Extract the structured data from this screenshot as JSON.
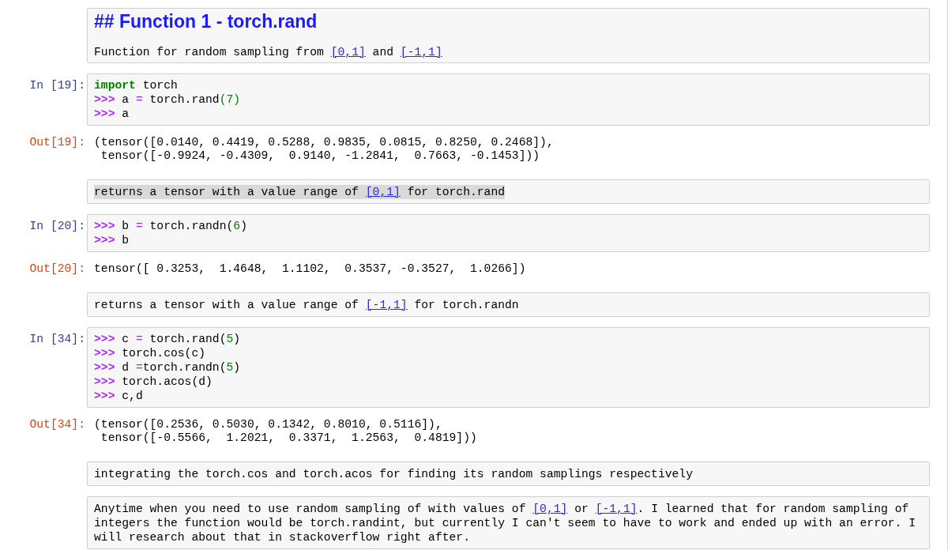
{
  "cells": [
    {
      "kind": "markdown",
      "highlighted": false,
      "heading": "## Function 1 - torch.rand",
      "paragraph": [
        {
          "kind": "text",
          "text": "Function for random sampling from "
        },
        {
          "kind": "link",
          "text": "[0,1]"
        },
        {
          "kind": "text",
          "text": " and "
        },
        {
          "kind": "link",
          "text": "[-1,1]"
        }
      ]
    },
    {
      "kind": "code",
      "prompt": "In [19]:",
      "lines": [
        [
          {
            "kind": "keyword",
            "text": "import"
          },
          {
            "kind": "plain",
            "text": " torch"
          }
        ],
        [
          {
            "kind": "prompt",
            "text": ">>>"
          },
          {
            "kind": "plain",
            "text": " a "
          },
          {
            "kind": "operator",
            "text": "="
          },
          {
            "kind": "plain",
            "text": " torch.rand"
          },
          {
            "kind": "number",
            "text": "(7)"
          }
        ],
        [
          {
            "kind": "prompt",
            "text": ">>>"
          },
          {
            "kind": "plain",
            "text": " a"
          }
        ]
      ]
    },
    {
      "kind": "output",
      "prompt": "Out[19]:",
      "lines": [
        "(tensor([0.0140, 0.4419, 0.5288, 0.9835, 0.0815, 0.8250, 0.2468]),",
        " tensor([-0.9924, -0.4309,  0.9140, -1.2841,  0.7663, -0.1453]))"
      ]
    },
    {
      "kind": "markdown",
      "highlighted": true,
      "paragraph": [
        {
          "kind": "text",
          "text": "returns a tensor with a value range of "
        },
        {
          "kind": "link",
          "text": "[0,1]"
        },
        {
          "kind": "text",
          "text": " for torch.rand"
        }
      ]
    },
    {
      "kind": "code",
      "prompt": "In [20]:",
      "lines": [
        [
          {
            "kind": "prompt",
            "text": ">>>"
          },
          {
            "kind": "plain",
            "text": " b "
          },
          {
            "kind": "operator",
            "text": "="
          },
          {
            "kind": "plain",
            "text": " torch.randn("
          },
          {
            "kind": "number",
            "text": "6"
          },
          {
            "kind": "plain",
            "text": ")"
          }
        ],
        [
          {
            "kind": "prompt",
            "text": ">>>"
          },
          {
            "kind": "plain",
            "text": " b"
          }
        ]
      ]
    },
    {
      "kind": "output",
      "prompt": "Out[20]:",
      "lines": [
        "tensor([ 0.3253,  1.4648,  1.1102,  0.3537, -0.3527,  1.0266])"
      ]
    },
    {
      "kind": "markdown",
      "highlighted": false,
      "paragraph": [
        {
          "kind": "text",
          "text": "returns a tensor with a value range of "
        },
        {
          "kind": "link",
          "text": "[-1,1]"
        },
        {
          "kind": "text",
          "text": " for torch.randn"
        }
      ]
    },
    {
      "kind": "code",
      "prompt": "In [34]:",
      "lines": [
        [
          {
            "kind": "prompt",
            "text": ">>>"
          },
          {
            "kind": "plain",
            "text": " c "
          },
          {
            "kind": "operator",
            "text": "="
          },
          {
            "kind": "plain",
            "text": " torch.rand("
          },
          {
            "kind": "number",
            "text": "5"
          },
          {
            "kind": "plain",
            "text": ")"
          }
        ],
        [
          {
            "kind": "prompt",
            "text": ">>>"
          },
          {
            "kind": "plain",
            "text": " torch.cos(c)"
          }
        ],
        [
          {
            "kind": "prompt",
            "text": ">>>"
          },
          {
            "kind": "plain",
            "text": " d "
          },
          {
            "kind": "operator",
            "text": "="
          },
          {
            "kind": "plain",
            "text": "torch.randn("
          },
          {
            "kind": "number",
            "text": "5"
          },
          {
            "kind": "plain",
            "text": ")"
          }
        ],
        [
          {
            "kind": "prompt",
            "text": ">>>"
          },
          {
            "kind": "plain",
            "text": " torch.acos(d)"
          }
        ],
        [
          {
            "kind": "prompt",
            "text": ">>>"
          },
          {
            "kind": "plain",
            "text": " c,d"
          }
        ]
      ]
    },
    {
      "kind": "output",
      "prompt": "Out[34]:",
      "lines": [
        "(tensor([0.2536, 0.5030, 0.1342, 0.8010, 0.5116]),",
        " tensor([-0.5566,  1.2021,  0.3371,  1.2563,  0.4819]))"
      ]
    },
    {
      "kind": "markdown",
      "highlighted": false,
      "paragraph": [
        {
          "kind": "text",
          "text": "integrating the torch.cos and torch.acos for finding its random samplings respectively"
        }
      ]
    },
    {
      "kind": "markdown",
      "highlighted": false,
      "paragraph": [
        {
          "kind": "text",
          "text": "Anytime when you need to use random sampling of with values of "
        },
        {
          "kind": "link",
          "text": "[0,1]"
        },
        {
          "kind": "text",
          "text": " or "
        },
        {
          "kind": "link",
          "text": "[-1,1]"
        },
        {
          "kind": "text",
          "text": ". I learned that for random sampling of integers the function would be torch.randint, but currently I can't seem to have to work and ended up with an error. I will research about that in stackoverflow right after."
        }
      ]
    }
  ]
}
